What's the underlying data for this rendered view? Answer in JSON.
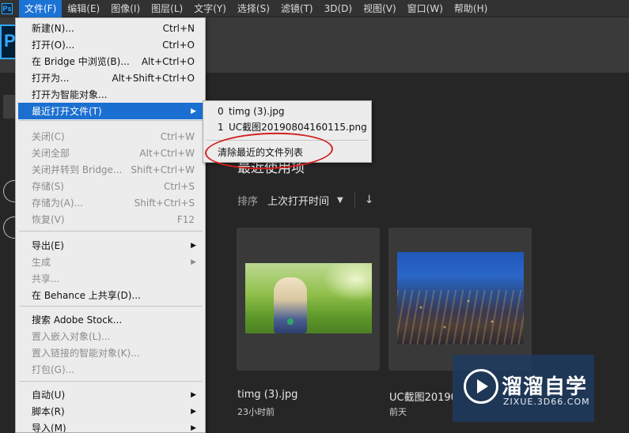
{
  "app": {
    "mini_logo": "Ps",
    "logo": "Ps"
  },
  "menubar": {
    "items": [
      "文件(F)",
      "编辑(E)",
      "图像(I)",
      "图层(L)",
      "文字(Y)",
      "选择(S)",
      "滤镜(T)",
      "3D(D)",
      "视图(V)",
      "窗口(W)",
      "帮助(H)"
    ],
    "active_index": 0
  },
  "home": {
    "recent_heading": "最近使用项",
    "sort_label": "排序",
    "sort_value": "上次打开时间",
    "sort_chevron_icon": "chevron-down-icon",
    "sort_direction_icon": "arrow-down-icon",
    "recent_files": [
      {
        "title": "timg (3).jpg",
        "subtitle": "23小时前"
      },
      {
        "title": "UC截图20190",
        "subtitle": "前天"
      }
    ]
  },
  "file_menu": {
    "items": [
      {
        "label": "新建(N)...",
        "shortcut": "Ctrl+N"
      },
      {
        "label": "打开(O)...",
        "shortcut": "Ctrl+O"
      },
      {
        "label": "在 Bridge 中浏览(B)...",
        "shortcut": "Alt+Ctrl+O"
      },
      {
        "label": "打开为...",
        "shortcut": "Alt+Shift+Ctrl+O"
      },
      {
        "label": "打开为智能对象...",
        "shortcut": ""
      },
      {
        "label": "最近打开文件(T)",
        "shortcut": "",
        "submenu": true,
        "highlighted": true
      },
      {
        "label": "关闭(C)",
        "shortcut": "Ctrl+W",
        "disabled": true
      },
      {
        "label": "关闭全部",
        "shortcut": "Alt+Ctrl+W",
        "disabled": true
      },
      {
        "label": "关闭并转到 Bridge...",
        "shortcut": "Shift+Ctrl+W",
        "disabled": true
      },
      {
        "label": "存储(S)",
        "shortcut": "Ctrl+S",
        "disabled": true
      },
      {
        "label": "存储为(A)...",
        "shortcut": "Shift+Ctrl+S",
        "disabled": true
      },
      {
        "label": "恢复(V)",
        "shortcut": "F12",
        "disabled": true
      },
      {
        "label": "导出(E)",
        "shortcut": "",
        "submenu": true
      },
      {
        "label": "生成",
        "shortcut": "",
        "submenu": true,
        "disabled": true
      },
      {
        "label": "共享...",
        "shortcut": "",
        "disabled": true
      },
      {
        "label": "在 Behance 上共享(D)...",
        "shortcut": ""
      },
      {
        "label": "搜索 Adobe Stock...",
        "shortcut": ""
      },
      {
        "label": "置入嵌入对象(L)...",
        "shortcut": "",
        "disabled": true
      },
      {
        "label": "置入链接的智能对象(K)...",
        "shortcut": "",
        "disabled": true
      },
      {
        "label": "打包(G)...",
        "shortcut": "",
        "disabled": true
      },
      {
        "label": "自动(U)",
        "shortcut": "",
        "submenu": true
      },
      {
        "label": "脚本(R)",
        "shortcut": "",
        "submenu": true
      },
      {
        "label": "导入(M)",
        "shortcut": "",
        "submenu": true
      }
    ]
  },
  "recent_submenu": {
    "items": [
      {
        "index": "0",
        "name": "timg (3).jpg"
      },
      {
        "index": "1",
        "name": "UC截图20190804160115.png"
      }
    ],
    "clear_label": "清除最近的文件列表"
  },
  "watermark": {
    "brand_cn": "溜溜自学",
    "brand_url": "ZIXUE.3D66.COM",
    "icon": "play-icon"
  },
  "colors": {
    "menu_highlight": "#1b6fd1",
    "ps_blue": "#31a8ff",
    "annotation_red": "#d42020",
    "menu_background": "#ececec",
    "app_background": "#262626"
  }
}
